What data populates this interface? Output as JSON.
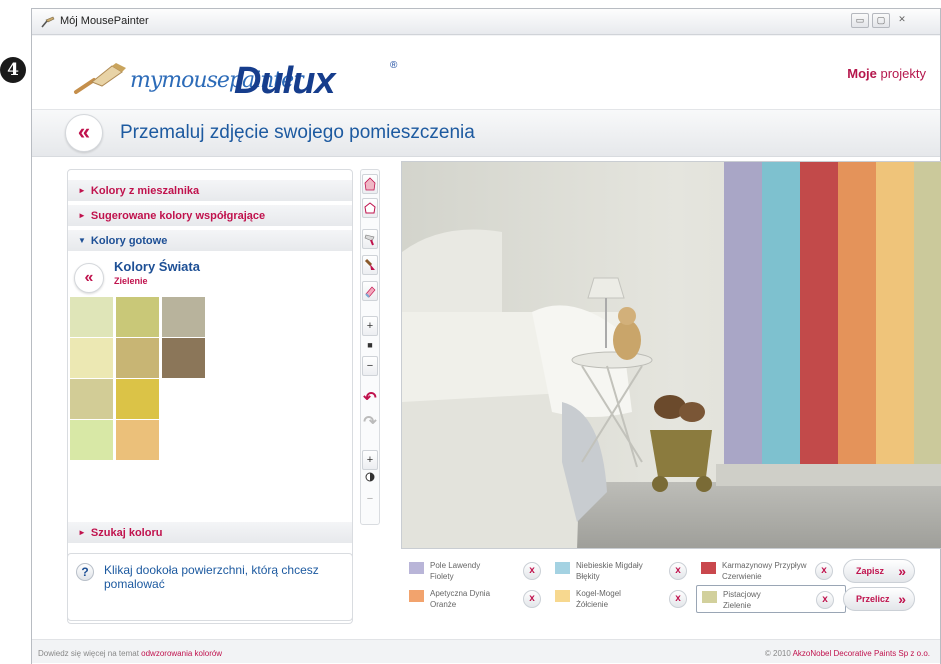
{
  "window": {
    "title": "Mój MousePainter",
    "buttons": {
      "minimize": "▭",
      "maximize": "▢",
      "close": "✕"
    }
  },
  "step_marker": "4",
  "logo": {
    "script": "mymousepainter",
    "brand": "Dulux",
    "trademark": "®"
  },
  "header": {
    "projects_bold": "Moje",
    "projects_rest": " projekty"
  },
  "band": {
    "back_glyph": "«",
    "title": "Przemaluj zdjęcie swojego pomieszczenia"
  },
  "left_panel": {
    "accordion": [
      {
        "label": "Kolory z mieszalnika",
        "arrow": "►"
      },
      {
        "label": "Sugerowane kolory współgrające",
        "arrow": "►"
      },
      {
        "label": "Kolory gotowe",
        "arrow": "▼"
      }
    ],
    "collection": {
      "back_glyph": "«",
      "title": "Kolory Świata",
      "subtitle": "Zielenie"
    },
    "swatches": [
      "#dfe5b8",
      "#c9c878",
      "#b8b39c",
      "#ece8b3",
      "#c8b574",
      "#8b7659",
      "#d2cc96",
      "#dbc347",
      "#d8e8a6",
      "#ebc07a"
    ],
    "search": {
      "label": "Szukaj koloru",
      "arrow": "►"
    }
  },
  "help": {
    "icon": "?",
    "text": "Klikaj dookoła powierzchni, którą chcesz pomalować"
  },
  "toolbar": {
    "zoom_in": "+",
    "zoom_size": "■",
    "zoom_out": "−",
    "undo": "↶",
    "redo": "↷",
    "contrast_plus": "+",
    "contrast_minus": "−"
  },
  "stripes": [
    "#a9a6c6",
    "#7ec1cf",
    "#c24a4a",
    "#e4935a",
    "#efc47a",
    "#cbc99b"
  ],
  "legend": {
    "items": [
      {
        "line1": "Pole Lawendy",
        "line2": "Fiolety",
        "color": "#b9b5d8",
        "x": "x"
      },
      {
        "line1": "Niebieskie Migdały",
        "line2": "Błękity",
        "color": "#a4d2e2",
        "x": "x"
      },
      {
        "line1": "Karmazynowy Przypływ",
        "line2": "Czerwienie",
        "color": "#c9474d",
        "x": "x"
      },
      {
        "line1": "Apetyczna Dynia",
        "line2": "Oranże",
        "color": "#f2a36d",
        "x": "x"
      },
      {
        "line1": "Kogel-Mogel",
        "line2": "Żółcienie",
        "color": "#f7d88f",
        "x": "x"
      },
      {
        "line1": "Pistacjowy",
        "line2": "Zielenie",
        "color": "#d2d09c",
        "x": "x"
      }
    ],
    "save": "Zapisz",
    "recalc": "Przelicz",
    "chev": "»"
  },
  "footer": {
    "left_text": "Dowiedz się więcej na temat ",
    "left_link": "odwzorowania kolorów",
    "right_text": "© 2010 ",
    "right_link": "AkzoNobel Decorative Paints Sp z o.o."
  }
}
